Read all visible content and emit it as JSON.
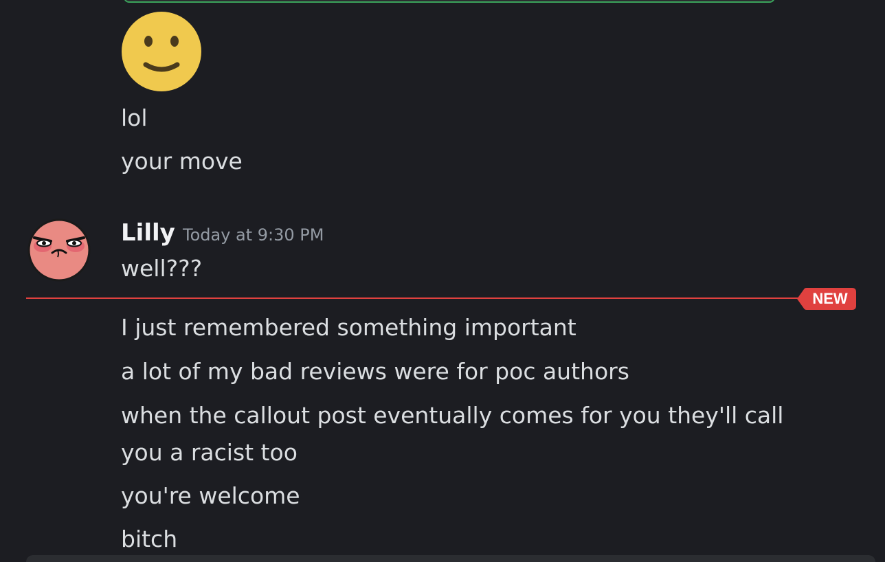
{
  "messages_before": [
    {
      "id": "m1",
      "text": "lol"
    },
    {
      "id": "m2",
      "text": "your move"
    }
  ],
  "emoji": {
    "icon": "slightly-smiling-face-icon",
    "color": "#f0c94e"
  },
  "author": {
    "name": "Lilly",
    "timestamp": "Today at 9:30 PM",
    "avatar": "annoyed-face-avatar"
  },
  "message_first": "well???",
  "new_divider": {
    "label": "NEW",
    "color": "#e0413f"
  },
  "messages_after": [
    "I just remembered something important",
    "a lot of my bad reviews were for poc authors",
    "when the callout post eventually comes for you they'll call",
    "you a racist too",
    "you're welcome",
    "bitch"
  ]
}
